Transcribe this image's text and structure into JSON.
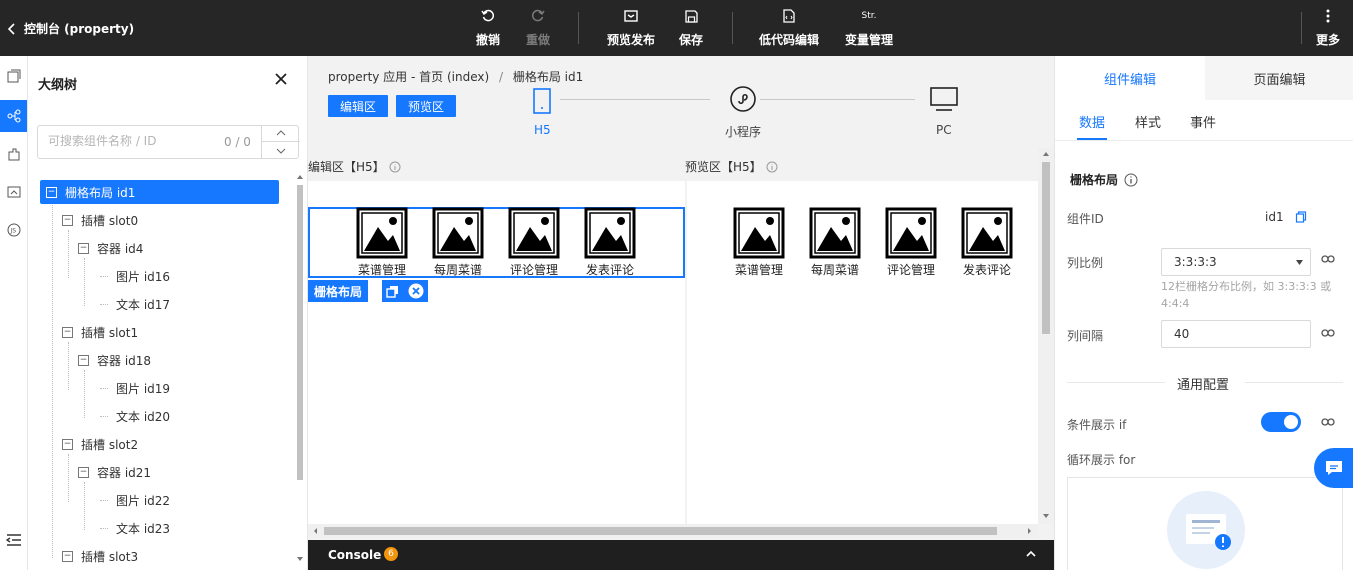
{
  "header": {
    "title": "控制台 (property)",
    "actions": {
      "undo": "撤销",
      "redo": "重做",
      "preview_publish": "预览发布",
      "save": "保存",
      "lowcode_edit": "低代码编辑",
      "var_mgmt": "变量管理",
      "more": "更多"
    },
    "var_icon_text": "Str."
  },
  "outline": {
    "title": "大纲树",
    "search_placeholder": "可搜索组件名称 / ID",
    "search_count": "0 / 0",
    "nodes": [
      {
        "label": "栅格布局 id1"
      },
      {
        "label": "插槽 slot0"
      },
      {
        "label": "容器 id4"
      },
      {
        "label": "图片 id16"
      },
      {
        "label": "文本 id17"
      },
      {
        "label": "插槽 slot1"
      },
      {
        "label": "容器 id18"
      },
      {
        "label": "图片 id19"
      },
      {
        "label": "文本 id20"
      },
      {
        "label": "插槽 slot2"
      },
      {
        "label": "容器 id21"
      },
      {
        "label": "图片 id22"
      },
      {
        "label": "文本 id23"
      },
      {
        "label": "插槽 slot3"
      }
    ]
  },
  "editor": {
    "breadcrumb_root": "property 应用 - 首页 (index)",
    "breadcrumb_sep": "/",
    "breadcrumb_current": "栅格布局 id1",
    "edit_btn": "编辑区",
    "preview_btn": "预览区",
    "devices": [
      "H5",
      "小程序",
      "PC"
    ],
    "edit_area_label": "编辑区【H5】",
    "preview_area_label": "预览区【H5】",
    "items": [
      "菜谱管理",
      "每周菜谱",
      "评论管理",
      "发表评论"
    ],
    "selected_tag": "栅格布局",
    "console_label": "Console",
    "console_count": "6"
  },
  "props": {
    "tabs": [
      "组件编辑",
      "页面编辑"
    ],
    "subtabs": [
      "数据",
      "样式",
      "事件"
    ],
    "section_title": "栅格布局",
    "component_id_label": "组件ID",
    "component_id": "id1",
    "col_ratio_label": "列比例",
    "col_ratio_value": "3:3:3:3",
    "col_ratio_hint": "12栏栅格分布比例，如 3:3:3:3 或 4:4:4",
    "col_gap_label": "列间隔",
    "col_gap_value": "40",
    "general_config": "通用配置",
    "cond_show_label": "条件展示 if",
    "loop_show_label": "循环展示 for"
  },
  "colors": {
    "accent": "#1677ff",
    "topbar": "#262626"
  }
}
